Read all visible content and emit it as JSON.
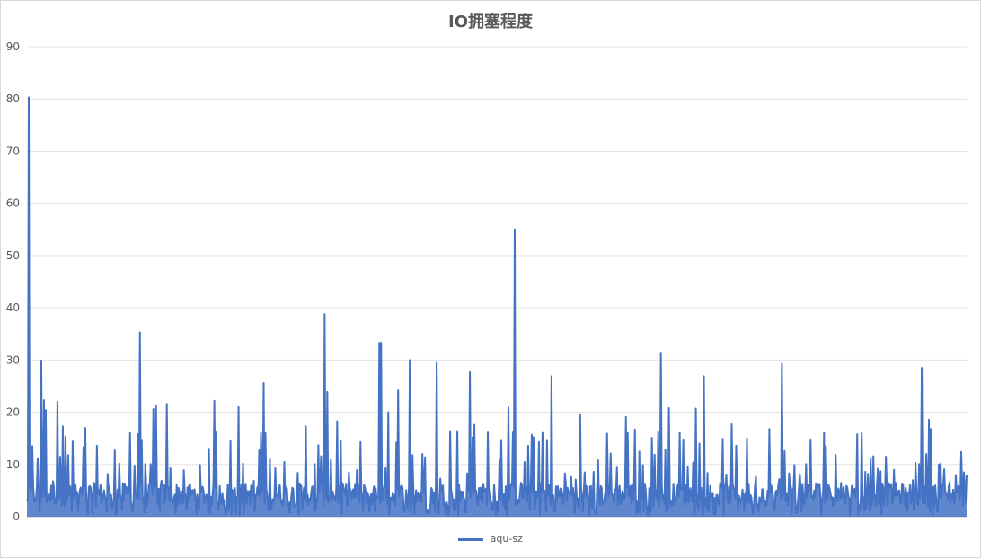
{
  "chart_data": {
    "type": "line",
    "title": "IO拥塞程度",
    "xlabel": "",
    "ylabel": "",
    "ylim": [
      0,
      90
    ],
    "yticks": [
      0,
      10,
      20,
      30,
      40,
      50,
      60,
      70,
      80,
      90
    ],
    "grid": true,
    "legend_position": "bottom",
    "color": "#4472c4",
    "series": [
      {
        "name": "aqu-sz",
        "peaks": [
          [
            0,
            3
          ],
          [
            2,
            80.3
          ],
          [
            6,
            13.5
          ],
          [
            12,
            11.2
          ],
          [
            16,
            29.9
          ],
          [
            19,
            22.3
          ],
          [
            21,
            20.4
          ],
          [
            29,
            6.8
          ],
          [
            34,
            22
          ],
          [
            37,
            11.5
          ],
          [
            40,
            17.3
          ],
          [
            43,
            15.3
          ],
          [
            46,
            11.8
          ],
          [
            51,
            14.4
          ],
          [
            63,
            13.3
          ],
          [
            65,
            17
          ],
          [
            78,
            13.6
          ],
          [
            90,
            8.2
          ],
          [
            98,
            12.7
          ],
          [
            103,
            10.2
          ],
          [
            115,
            16
          ],
          [
            120,
            9.8
          ],
          [
            124,
            15.8
          ],
          [
            126,
            35.3
          ],
          [
            128,
            14.7
          ],
          [
            132,
            10.1
          ],
          [
            138,
            10.1
          ],
          [
            141,
            20.6
          ],
          [
            144,
            21.2
          ],
          [
            150,
            6.9
          ],
          [
            156,
            21.6
          ],
          [
            160,
            9.3
          ],
          [
            175,
            8.9
          ],
          [
            182,
            6
          ],
          [
            193,
            9.9
          ],
          [
            203,
            13
          ],
          [
            209,
            22.2
          ],
          [
            211,
            16.3
          ],
          [
            227,
            14.5
          ],
          [
            236,
            21
          ],
          [
            241,
            10.2
          ],
          [
            253,
            6.9
          ],
          [
            259,
            12.7
          ],
          [
            261,
            16
          ],
          [
            264,
            25.6
          ],
          [
            266,
            16
          ],
          [
            271,
            11
          ],
          [
            277,
            9.3
          ],
          [
            287,
            10.5
          ],
          [
            297,
            5.3
          ],
          [
            302,
            8.4
          ],
          [
            311,
            17.3
          ],
          [
            321,
            10.1
          ],
          [
            325,
            13.7
          ],
          [
            328,
            11.6
          ],
          [
            332,
            38.8
          ],
          [
            335,
            23.9
          ],
          [
            339,
            10.9
          ],
          [
            346,
            18.3
          ],
          [
            350,
            14.5
          ],
          [
            359,
            8.5
          ],
          [
            368,
            8.9
          ],
          [
            372,
            14.3
          ],
          [
            378,
            4.6
          ],
          [
            386,
            4.4
          ],
          [
            393,
            33.3
          ],
          [
            395,
            33.3
          ],
          [
            400,
            9.3
          ],
          [
            403,
            20
          ],
          [
            412,
            14.2
          ],
          [
            414,
            24.2
          ],
          [
            423,
            5.1
          ],
          [
            427,
            30
          ],
          [
            430,
            11.8
          ],
          [
            441,
            12
          ],
          [
            444,
            11.4
          ],
          [
            457,
            29.7
          ],
          [
            461,
            7.3
          ],
          [
            472,
            16.4
          ],
          [
            480,
            16.4
          ],
          [
            486,
            4.8
          ],
          [
            491,
            8.3
          ],
          [
            494,
            27.7
          ],
          [
            497,
            15.2
          ],
          [
            499,
            17.6
          ],
          [
            504,
            5.5
          ],
          [
            514,
            16.3
          ],
          [
            527,
            10.8
          ],
          [
            529,
            14.7
          ],
          [
            537,
            20.9
          ],
          [
            542,
            16.3
          ],
          [
            544,
            55
          ],
          [
            551,
            6.5
          ],
          [
            555,
            10.5
          ],
          [
            559,
            13.6
          ],
          [
            563,
            15.7
          ],
          [
            565,
            15.2
          ],
          [
            571,
            14.3
          ],
          [
            575,
            16.2
          ],
          [
            580,
            14.7
          ],
          [
            585,
            26.9
          ],
          [
            595,
            5.4
          ],
          [
            600,
            8.3
          ],
          [
            607,
            7.6
          ],
          [
            612,
            7.1
          ],
          [
            617,
            19.6
          ],
          [
            622,
            8.5
          ],
          [
            632,
            8.6
          ],
          [
            637,
            10.8
          ],
          [
            647,
            15.9
          ],
          [
            651,
            12.1
          ],
          [
            658,
            9.4
          ],
          [
            668,
            19.1
          ],
          [
            670,
            16.1
          ],
          [
            678,
            16.7
          ],
          [
            683,
            12.5
          ],
          [
            687,
            9.9
          ],
          [
            697,
            15.1
          ],
          [
            700,
            11.9
          ],
          [
            704,
            16.4
          ],
          [
            707,
            31.4
          ],
          [
            712,
            12.9
          ],
          [
            716,
            20.8
          ],
          [
            728,
            16.1
          ],
          [
            732,
            14.8
          ],
          [
            737,
            9.5
          ],
          [
            743,
            10.4
          ],
          [
            746,
            20.7
          ],
          [
            750,
            14
          ],
          [
            755,
            26.9
          ],
          [
            759,
            8.4
          ],
          [
            776,
            14.9
          ],
          [
            780,
            8.1
          ],
          [
            786,
            17.7
          ],
          [
            791,
            13.6
          ],
          [
            798,
            5.2
          ],
          [
            803,
            15
          ],
          [
            813,
            7.7
          ],
          [
            820,
            5.3
          ],
          [
            828,
            16.8
          ],
          [
            839,
            7.2
          ],
          [
            842,
            29.3
          ],
          [
            845,
            12.6
          ],
          [
            850,
            8.3
          ],
          [
            856,
            9.9
          ],
          [
            862,
            8.2
          ],
          [
            865,
            6.3
          ],
          [
            869,
            10.1
          ],
          [
            874,
            14.8
          ],
          [
            880,
            6.4
          ],
          [
            884,
            6.3
          ],
          [
            889,
            16.1
          ],
          [
            891,
            13.5
          ],
          [
            895,
            5.5
          ],
          [
            902,
            11.8
          ],
          [
            908,
            6.5
          ],
          [
            915,
            5.6
          ],
          [
            922,
            4.4
          ],
          [
            926,
            15.8
          ],
          [
            931,
            16
          ],
          [
            935,
            8.6
          ],
          [
            938,
            8.2
          ],
          [
            941,
            11.3
          ],
          [
            944,
            11.6
          ],
          [
            949,
            9.2
          ],
          [
            952,
            8.7
          ],
          [
            955,
            5.5
          ],
          [
            958,
            11.5
          ],
          [
            962,
            6.2
          ],
          [
            967,
            9
          ],
          [
            981,
            4.5
          ],
          [
            984,
            4.5
          ],
          [
            988,
            7
          ],
          [
            991,
            10.3
          ],
          [
            995,
            10.1
          ],
          [
            998,
            28.5
          ],
          [
            1003,
            12
          ],
          [
            1006,
            18.6
          ],
          [
            1008,
            16.8
          ],
          [
            1013,
            6
          ],
          [
            1017,
            10
          ],
          [
            1019,
            10.2
          ],
          [
            1023,
            9.1
          ],
          [
            1029,
            6.6
          ],
          [
            1036,
            8
          ],
          [
            1039,
            5.9
          ],
          [
            1042,
            12.4
          ],
          [
            1045,
            8.5
          ],
          [
            1048,
            8
          ]
        ]
      }
    ]
  }
}
